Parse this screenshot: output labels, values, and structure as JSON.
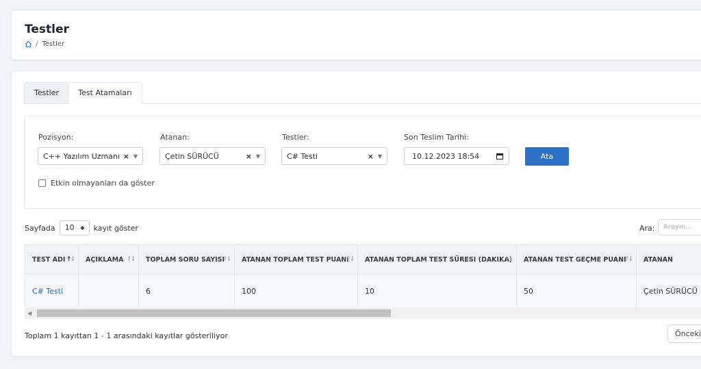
{
  "page": {
    "title": "Testler",
    "breadcrumb": {
      "home_icon": "home-icon",
      "current": "Testler"
    }
  },
  "tabs": [
    {
      "label": "Testler",
      "active": true
    },
    {
      "label": "Test Atamaları",
      "active": false
    }
  ],
  "filters": {
    "pozisyon": {
      "label": "Pozisyon:",
      "value": "C++ Yazılım Uzmanı",
      "clear": "×"
    },
    "atanan": {
      "label": "Atanan:",
      "value": "Çetin SÜRÜCÜ",
      "clear": "×"
    },
    "testler": {
      "label": "Testler:",
      "value": "C# Testi",
      "clear": "×"
    },
    "son_teslim": {
      "label": "Son Teslim Tarihi:",
      "value": "10.12.2023 18:54"
    },
    "assign_button": "Ata",
    "inactive_checkbox": {
      "label": "Etkin olmayanları da göster",
      "checked": false
    }
  },
  "table_controls": {
    "length_prefix": "Sayfada",
    "length_value": "10",
    "length_suffix": "kayıt göster",
    "search_label": "Ara:",
    "search_placeholder": "Arayın..."
  },
  "table": {
    "columns": [
      "TEST ADI",
      "AÇIKLAMA",
      "TOPLAM SORU SAYISI",
      "ATANAN TOPLAM TEST PUANI",
      "ATANAN TOPLAM TEST SÜRESI (DAKIKA)",
      "ATANAN TEST GEÇME PUANI",
      "ATANAN"
    ],
    "rows": [
      [
        "C# Testi",
        "",
        "6",
        "100",
        "10",
        "50",
        "Çetin SÜRÜCÜ"
      ]
    ]
  },
  "footer": {
    "info": "Toplam 1 kayıttan 1 - 1 arasındaki kayıtlar gösteriliyor",
    "prev_button": "Önceki"
  },
  "colors": {
    "primary": "#2e72c7",
    "link": "#2c6db8",
    "background": "#f2f3f7"
  }
}
